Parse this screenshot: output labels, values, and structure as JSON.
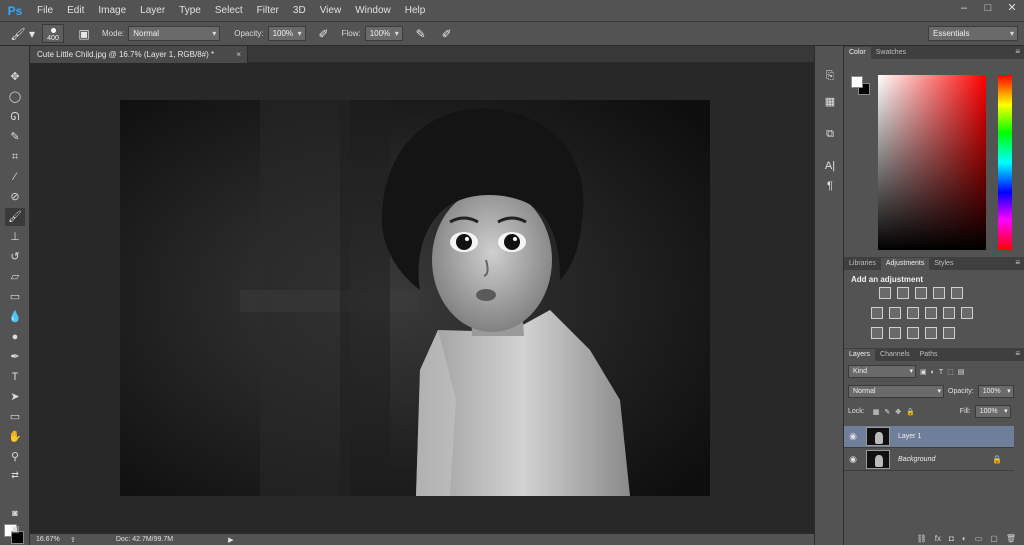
{
  "app": {
    "logo": "Ps"
  },
  "menu": [
    "File",
    "Edit",
    "Image",
    "Layer",
    "Type",
    "Select",
    "Filter",
    "3D",
    "View",
    "Window",
    "Help"
  ],
  "window_controls": [
    "minimize",
    "maximize",
    "close"
  ],
  "options": {
    "brush_size": "400",
    "mode_label": "Mode:",
    "mode_value": "Normal",
    "opacity_label": "Opacity:",
    "opacity_value": "100%",
    "flow_label": "Flow:",
    "flow_value": "100%",
    "workspace": "Essentials"
  },
  "document": {
    "tab_title": "Cute Little Child.jpg @ 16.7% (Layer 1, RGB/8#) *",
    "close": "×"
  },
  "status": {
    "zoom": "16.67%",
    "doc": "Doc: 42.7M/99.7M"
  },
  "color_panel": {
    "tabs": [
      "Color",
      "Swatches"
    ],
    "menu": "≡"
  },
  "adjustments_panel": {
    "tabs": [
      "Libraries",
      "Adjustments",
      "Styles"
    ],
    "title": "Add an adjustment",
    "menu": "≡"
  },
  "layers_panel": {
    "tabs": [
      "Layers",
      "Channels",
      "Paths"
    ],
    "filter_kind": "Kind",
    "blend_mode": "Normal",
    "opacity_label": "Opacity:",
    "opacity_value": "100%",
    "lock_label": "Lock:",
    "fill_label": "Fill:",
    "fill_value": "100%",
    "menu": "≡",
    "layers": [
      {
        "name": "Layer 1",
        "selected": true
      },
      {
        "name": "Background",
        "selected": false,
        "locked": true
      }
    ],
    "footer_icons": [
      "link-icon",
      "fx-icon",
      "mask-icon",
      "adjustment-icon",
      "group-icon",
      "new-layer-icon",
      "trash-icon"
    ]
  },
  "colors": {
    "foreground": "#ffffff",
    "background": "#000000",
    "selection": "#6f7f99"
  }
}
